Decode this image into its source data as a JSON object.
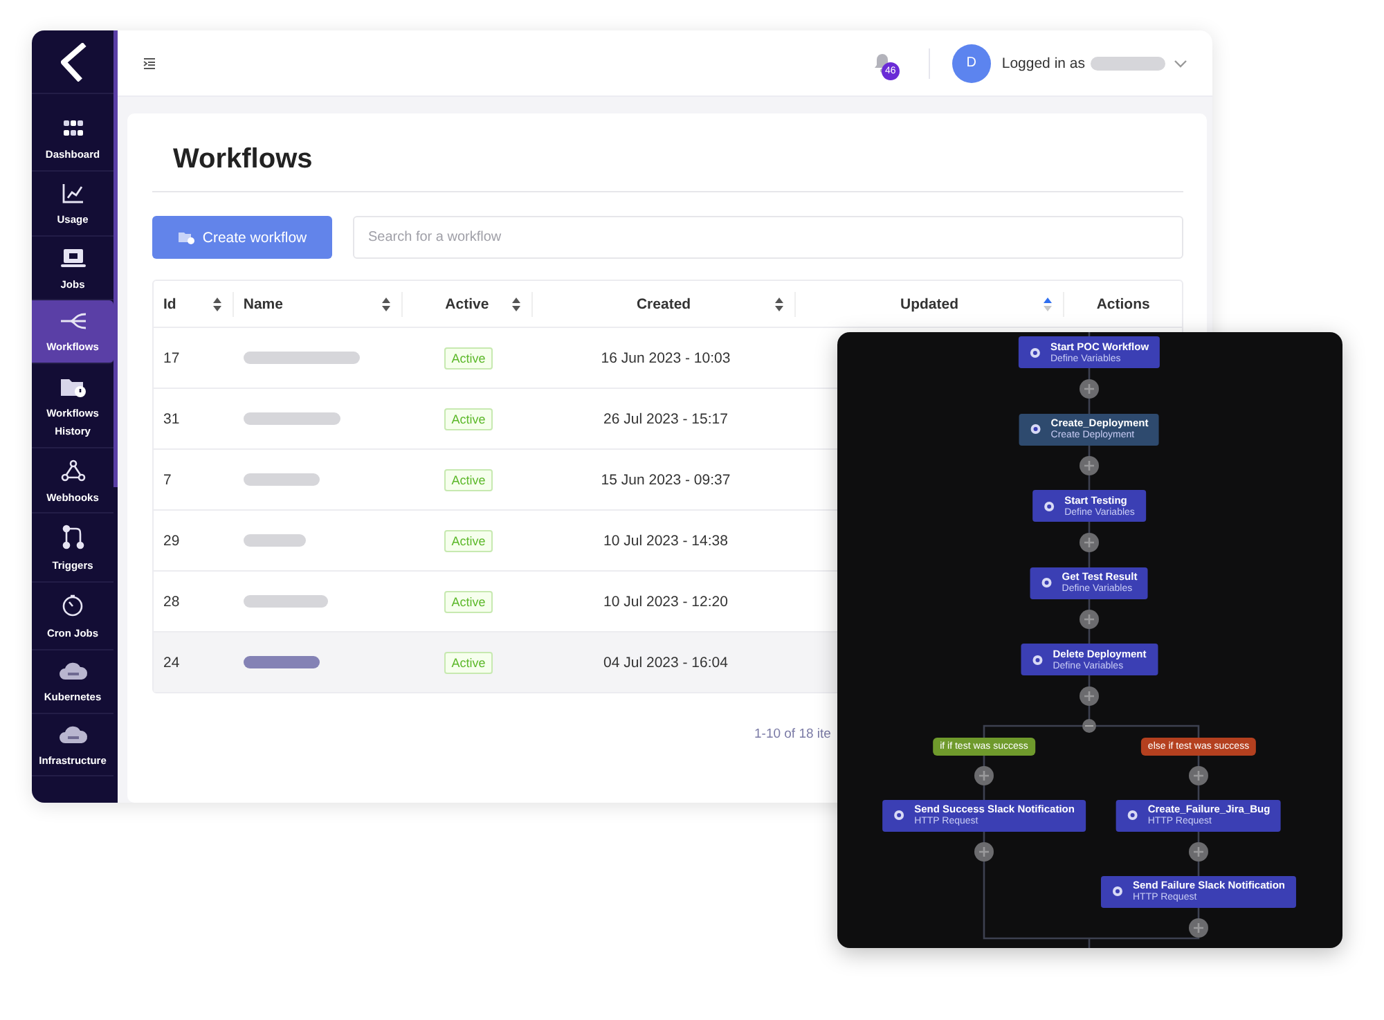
{
  "sidebar": {
    "items": [
      {
        "label": "Dashboard",
        "selected": false
      },
      {
        "label": "Usage",
        "selected": false
      },
      {
        "label": "Jobs",
        "selected": false
      },
      {
        "label": "Workflows",
        "selected": true
      },
      {
        "label": "Workflows History",
        "selected": false
      },
      {
        "label": "Webhooks",
        "selected": false
      },
      {
        "label": "Triggers",
        "selected": false
      },
      {
        "label": "Cron Jobs",
        "selected": false
      },
      {
        "label": "Kubernetes",
        "selected": false
      },
      {
        "label": "Infrastructure",
        "selected": false
      }
    ]
  },
  "header": {
    "notification_count": "46",
    "avatar": "D",
    "user_label": "Logged in as"
  },
  "page": {
    "title": "Workflows",
    "create_button": "Create workflow",
    "search": {
      "placeholder": "Search for a workflow"
    }
  },
  "table": {
    "columns": [
      {
        "label": "Id",
        "sortable": true,
        "sorted": false
      },
      {
        "label": "Name",
        "sortable": true,
        "sorted": false
      },
      {
        "label": "Active",
        "sortable": true,
        "sorted": false
      },
      {
        "label": "Created",
        "sortable": true,
        "sorted": false
      },
      {
        "label": "Updated",
        "sortable": true,
        "sorted": true
      },
      {
        "label": "Actions"
      }
    ],
    "rows": [
      {
        "id": "17",
        "status": "Active",
        "created": "16 Jun 2023 - 10:03",
        "highlighted": false
      },
      {
        "id": "31",
        "status": "Active",
        "created": "26 Jul 2023 - 15:17",
        "highlighted": false
      },
      {
        "id": "7",
        "status": "Active",
        "created": "15 Jun 2023 - 09:37",
        "highlighted": false
      },
      {
        "id": "29",
        "status": "Active",
        "created": "10 Jul 2023 - 14:38",
        "highlighted": false
      },
      {
        "id": "28",
        "status": "Active",
        "created": "10 Jul 2023 - 12:20",
        "highlighted": false
      },
      {
        "id": "24",
        "status": "Active",
        "created": "04 Jul 2023 - 16:04",
        "highlighted": true
      }
    ],
    "pagination": "1-10 of 18 ite"
  },
  "flow": {
    "steps": [
      {
        "title": "Start POC Workflow",
        "subtitle": "Define Variables",
        "color": "#3b3fb4"
      },
      {
        "title": "Create_Deployment",
        "subtitle": "Create Deployment",
        "color": "#2e4a6e"
      },
      {
        "title": "Start Testing",
        "subtitle": "Define Variables",
        "color": "#3b3fb4"
      },
      {
        "title": "Get Test Result",
        "subtitle": "Define Variables",
        "color": "#3b3fb4"
      },
      {
        "title": "Delete Deployment",
        "subtitle": "Define Variables",
        "color": "#3b3fb4"
      }
    ],
    "branches": [
      {
        "label": "if if test was success",
        "color": "#6f9a2c",
        "steps": [
          {
            "title": "Send Success Slack Notification",
            "subtitle": "HTTP Request",
            "color": "#3b3fb4"
          }
        ]
      },
      {
        "label": "else if test was success",
        "color": "#b4401f",
        "steps": [
          {
            "title": "Create_Failure_Jira_Bug",
            "subtitle": "HTTP Request",
            "color": "#3b3fb4"
          },
          {
            "title": "Send Failure Slack Notification",
            "subtitle": "HTTP Request",
            "color": "#3b3fb4"
          }
        ]
      }
    ]
  }
}
